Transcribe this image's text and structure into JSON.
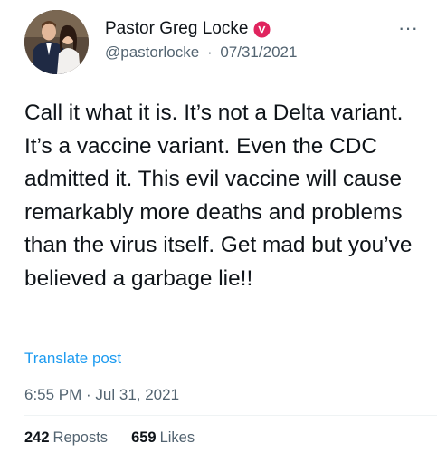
{
  "author": {
    "display_name": "Pastor Greg Locke",
    "handle": "@pastorlocke",
    "separator": "·",
    "date": "07/31/2021",
    "avatar_icon": "profile-photo",
    "verified_icon": "verified-badge-icon",
    "verified_color": "#e0245e"
  },
  "post": {
    "text": "Call it what it is. It’s not a Delta variant. It’s a vaccine variant. Even the CDC admitted it. This evil vaccine will cause remarkably more deaths and problems than the virus itself. Get mad but you’ve believed a garbage lie!!",
    "translate_label": "Translate post",
    "timestamp": "6:55 PM · Jul 31, 2021"
  },
  "stats": {
    "reposts_count": "242",
    "reposts_label": "Reposts",
    "likes_count": "659",
    "likes_label": "Likes"
  },
  "more_icon": "more-options-icon",
  "colors": {
    "link": "#1d9bf0",
    "muted": "#536471",
    "text": "#0f1419"
  }
}
